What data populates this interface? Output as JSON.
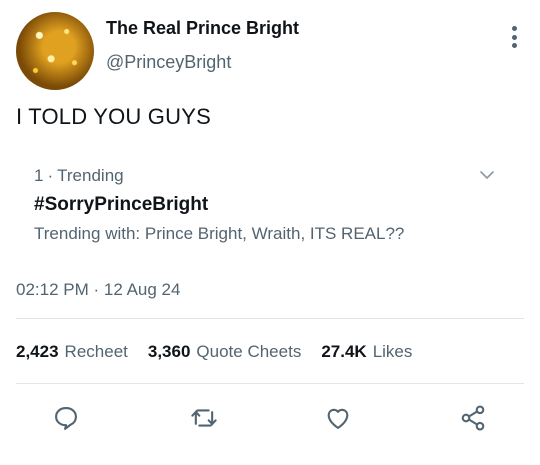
{
  "profile": {
    "display_name": "The Real Prince Bright",
    "handle": "@PrinceyBright"
  },
  "tweet": {
    "text": "I TOLD YOU GUYS"
  },
  "trend": {
    "rank": "1",
    "separator": "·",
    "label": "Trending",
    "hashtag": "#SorryPrinceBright",
    "trending_with": "Trending with: Prince Bright, Wraith, ITS REAL??"
  },
  "timestamp": "02:12 PM · 12 Aug 24",
  "stats": {
    "rechecks_count": "2,423",
    "rechecks_label": "Recheet",
    "quotes_count": "3,360",
    "quotes_label": "Quote Cheets",
    "likes_count": "27.4K",
    "likes_label": "Likes"
  },
  "icons": {
    "more": "more-vertical-icon",
    "chevron": "chevron-down-icon",
    "reply": "reply-icon",
    "recheet": "recheet-icon",
    "like": "heart-icon",
    "share": "share-icon"
  },
  "colors": {
    "icon": "#536471",
    "text_primary": "#0f1419",
    "text_secondary": "#536471",
    "divider": "#e1e6ea"
  }
}
